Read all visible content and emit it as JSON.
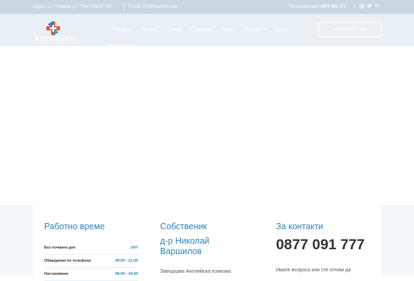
{
  "topbar": {
    "address": "Адрес: гр. Пловдив, ул. \"Хан Кубрат\" №1",
    "email": "E-mail: info@example.com",
    "phone_label": "Връзка/Контакт:",
    "phone_number": "0877 091 777",
    "socials": [
      "facebook-icon",
      "instagram-icon",
      "twitter-icon",
      "linkedin-icon"
    ]
  },
  "logo": {
    "word": "Хармония",
    "sub": "МЕДИЦИНСКИ ЦЕНТЪР"
  },
  "nav": {
    "items": [
      "Начало",
      "За нас",
      "Цени",
      "Галерия",
      "Екип",
      "Контакти",
      "Блог"
    ],
    "active": 0
  },
  "cta": {
    "label": "ЗАПАЗЕТЕ ЧАС"
  },
  "sections": {
    "hours": {
      "title": "Работно време",
      "rows": [
        {
          "label": "Без почивен ден",
          "value": "24/7"
        },
        {
          "label": "Обаждания по телефона",
          "value": "08:00 - 21:00"
        },
        {
          "label": "Настаняване",
          "value": "08:00 - 18:00"
        }
      ]
    },
    "owner": {
      "title": "Собственик",
      "name": "д-р Николай Варшилов",
      "text": "Завършва Английска езикова"
    },
    "contacts": {
      "title": "За контакти",
      "phone": "0877 091 777",
      "text": "Имате въпроси или сте готови да"
    }
  },
  "colors": {
    "accent": "#2d82ba",
    "header_bg": "#e9f0f5",
    "topbar_bg": "#c9d7e3"
  }
}
